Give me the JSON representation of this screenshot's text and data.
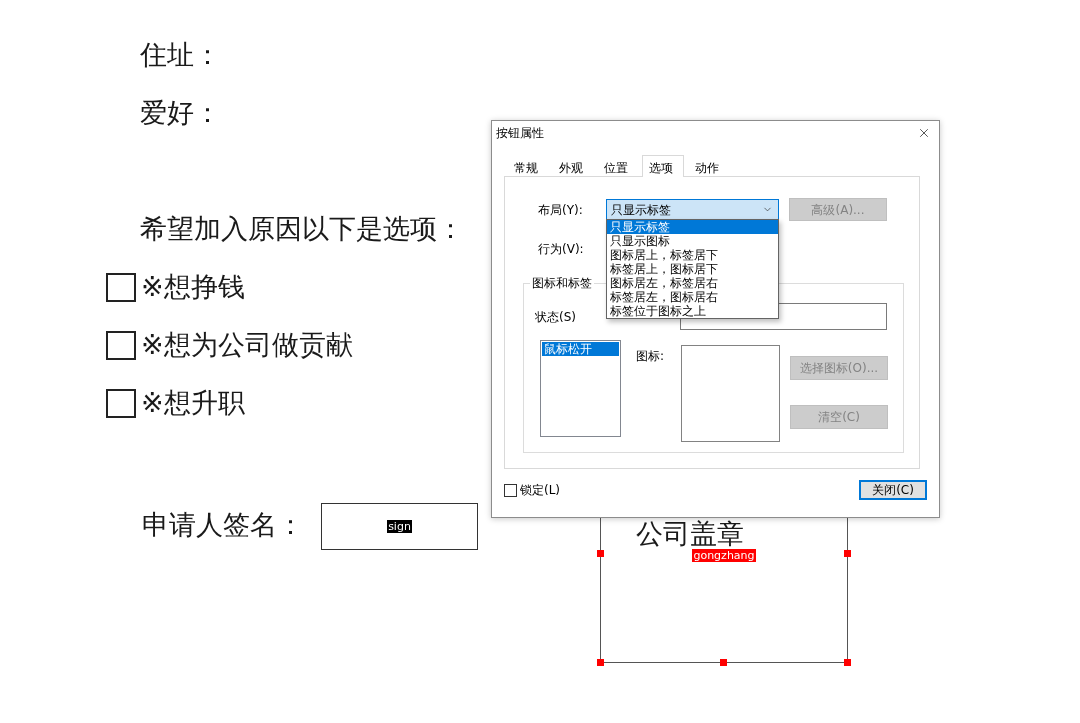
{
  "document": {
    "fields": [
      {
        "label": "住址："
      },
      {
        "label": "爱好："
      }
    ],
    "prompt": "希望加入原因以下是选项：",
    "options": [
      {
        "label": "※想挣钱",
        "checked": false
      },
      {
        "label": "※想为公司做贡献",
        "checked": false
      },
      {
        "label": "※想升职",
        "checked": false
      }
    ],
    "signature": {
      "label": "申请人签名：",
      "field_name": "sign",
      "selected": false
    },
    "stamp": {
      "label": "公司盖章",
      "field_name": "gongzhang",
      "selected": true
    }
  },
  "dialog": {
    "title": "按钮属性",
    "tabs": [
      {
        "label": "常规",
        "selected": false
      },
      {
        "label": "外观",
        "selected": false
      },
      {
        "label": "位置",
        "selected": false
      },
      {
        "label": "选项",
        "selected": true
      },
      {
        "label": "动作",
        "selected": false
      }
    ],
    "layout": {
      "label": "布局(Y):",
      "value": "只显示标签",
      "expanded": true,
      "options": [
        {
          "label": "只显示标签",
          "selected": true
        },
        {
          "label": "只显示图标",
          "selected": false
        },
        {
          "label": "图标居上，标签居下",
          "selected": false
        },
        {
          "label": "标签居上，图标居下",
          "selected": false
        },
        {
          "label": "图标居左，标签居右",
          "selected": false
        },
        {
          "label": "标签居左，图标居右",
          "selected": false
        },
        {
          "label": "标签位于图标之上",
          "selected": false
        }
      ]
    },
    "advanced_button": {
      "label": "高级(A)...",
      "disabled": true
    },
    "behavior": {
      "label": "行为(V):"
    },
    "icon_and_label": {
      "title": "图标和标签",
      "state_label": "状态(S)",
      "states": [
        {
          "label": "鼠标松开",
          "selected": true
        }
      ],
      "icon_label": "图标:",
      "buttons": [
        {
          "label": "选择图标(O)...",
          "disabled": true
        },
        {
          "label": "清空(C)",
          "disabled": true
        }
      ]
    },
    "lock": {
      "label": "锁定(L)",
      "checked": false
    },
    "close_button": {
      "label": "关闭(C)",
      "focused": true
    }
  }
}
